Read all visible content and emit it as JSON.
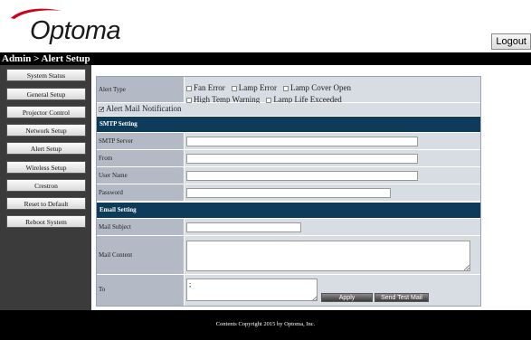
{
  "header": {
    "brand": "Optoma",
    "logout_label": "Logout"
  },
  "breadcrumb": "Admin > Alert Setup",
  "sidebar": {
    "items": [
      {
        "label": "System Status"
      },
      {
        "label": "General Setup"
      },
      {
        "label": "Projector Control"
      },
      {
        "label": "Network Setup"
      },
      {
        "label": "Alert Setup"
      },
      {
        "label": "Wireless Setup"
      },
      {
        "label": "Crestron"
      },
      {
        "label": "Reset to Default"
      },
      {
        "label": "Reboot System"
      }
    ]
  },
  "alert": {
    "type_label": "Alert Type",
    "options": [
      {
        "label": "Fan Error",
        "checked": false
      },
      {
        "label": "Lamp Error",
        "checked": false
      },
      {
        "label": "Lamp Cover Open",
        "checked": false
      },
      {
        "label": "High Temp Warning",
        "checked": false
      },
      {
        "label": "Lamp Life Exceeded",
        "checked": false
      }
    ],
    "mail_notification_label": "Alert Mail Notification",
    "mail_notification_checked": true
  },
  "smtp": {
    "section_title": "SMTP Setting",
    "server_label": "SMTP Server",
    "server_value": "",
    "from_label": "From",
    "from_value": "",
    "user_label": "User Name",
    "user_value": "",
    "password_label": "Password",
    "password_value": ""
  },
  "email": {
    "section_title": "Email Setting",
    "subject_label": "Mail Subject",
    "subject_value": "",
    "content_label": "Mail Content",
    "content_value": "",
    "to_label": "To",
    "to_value": ";",
    "apply_label": "Apply",
    "test_mail_label": "Send Test Mail"
  },
  "footer": {
    "copyright": "Contents Copyright 2015 by Optoma, Inc."
  },
  "colors": {
    "brand_red": "#d0021b",
    "section_bg": "#0f3b5a",
    "label_bg": "#b3bac6",
    "value_bg": "#d8dce3",
    "sidebar_bg": "#3b3b3b"
  }
}
